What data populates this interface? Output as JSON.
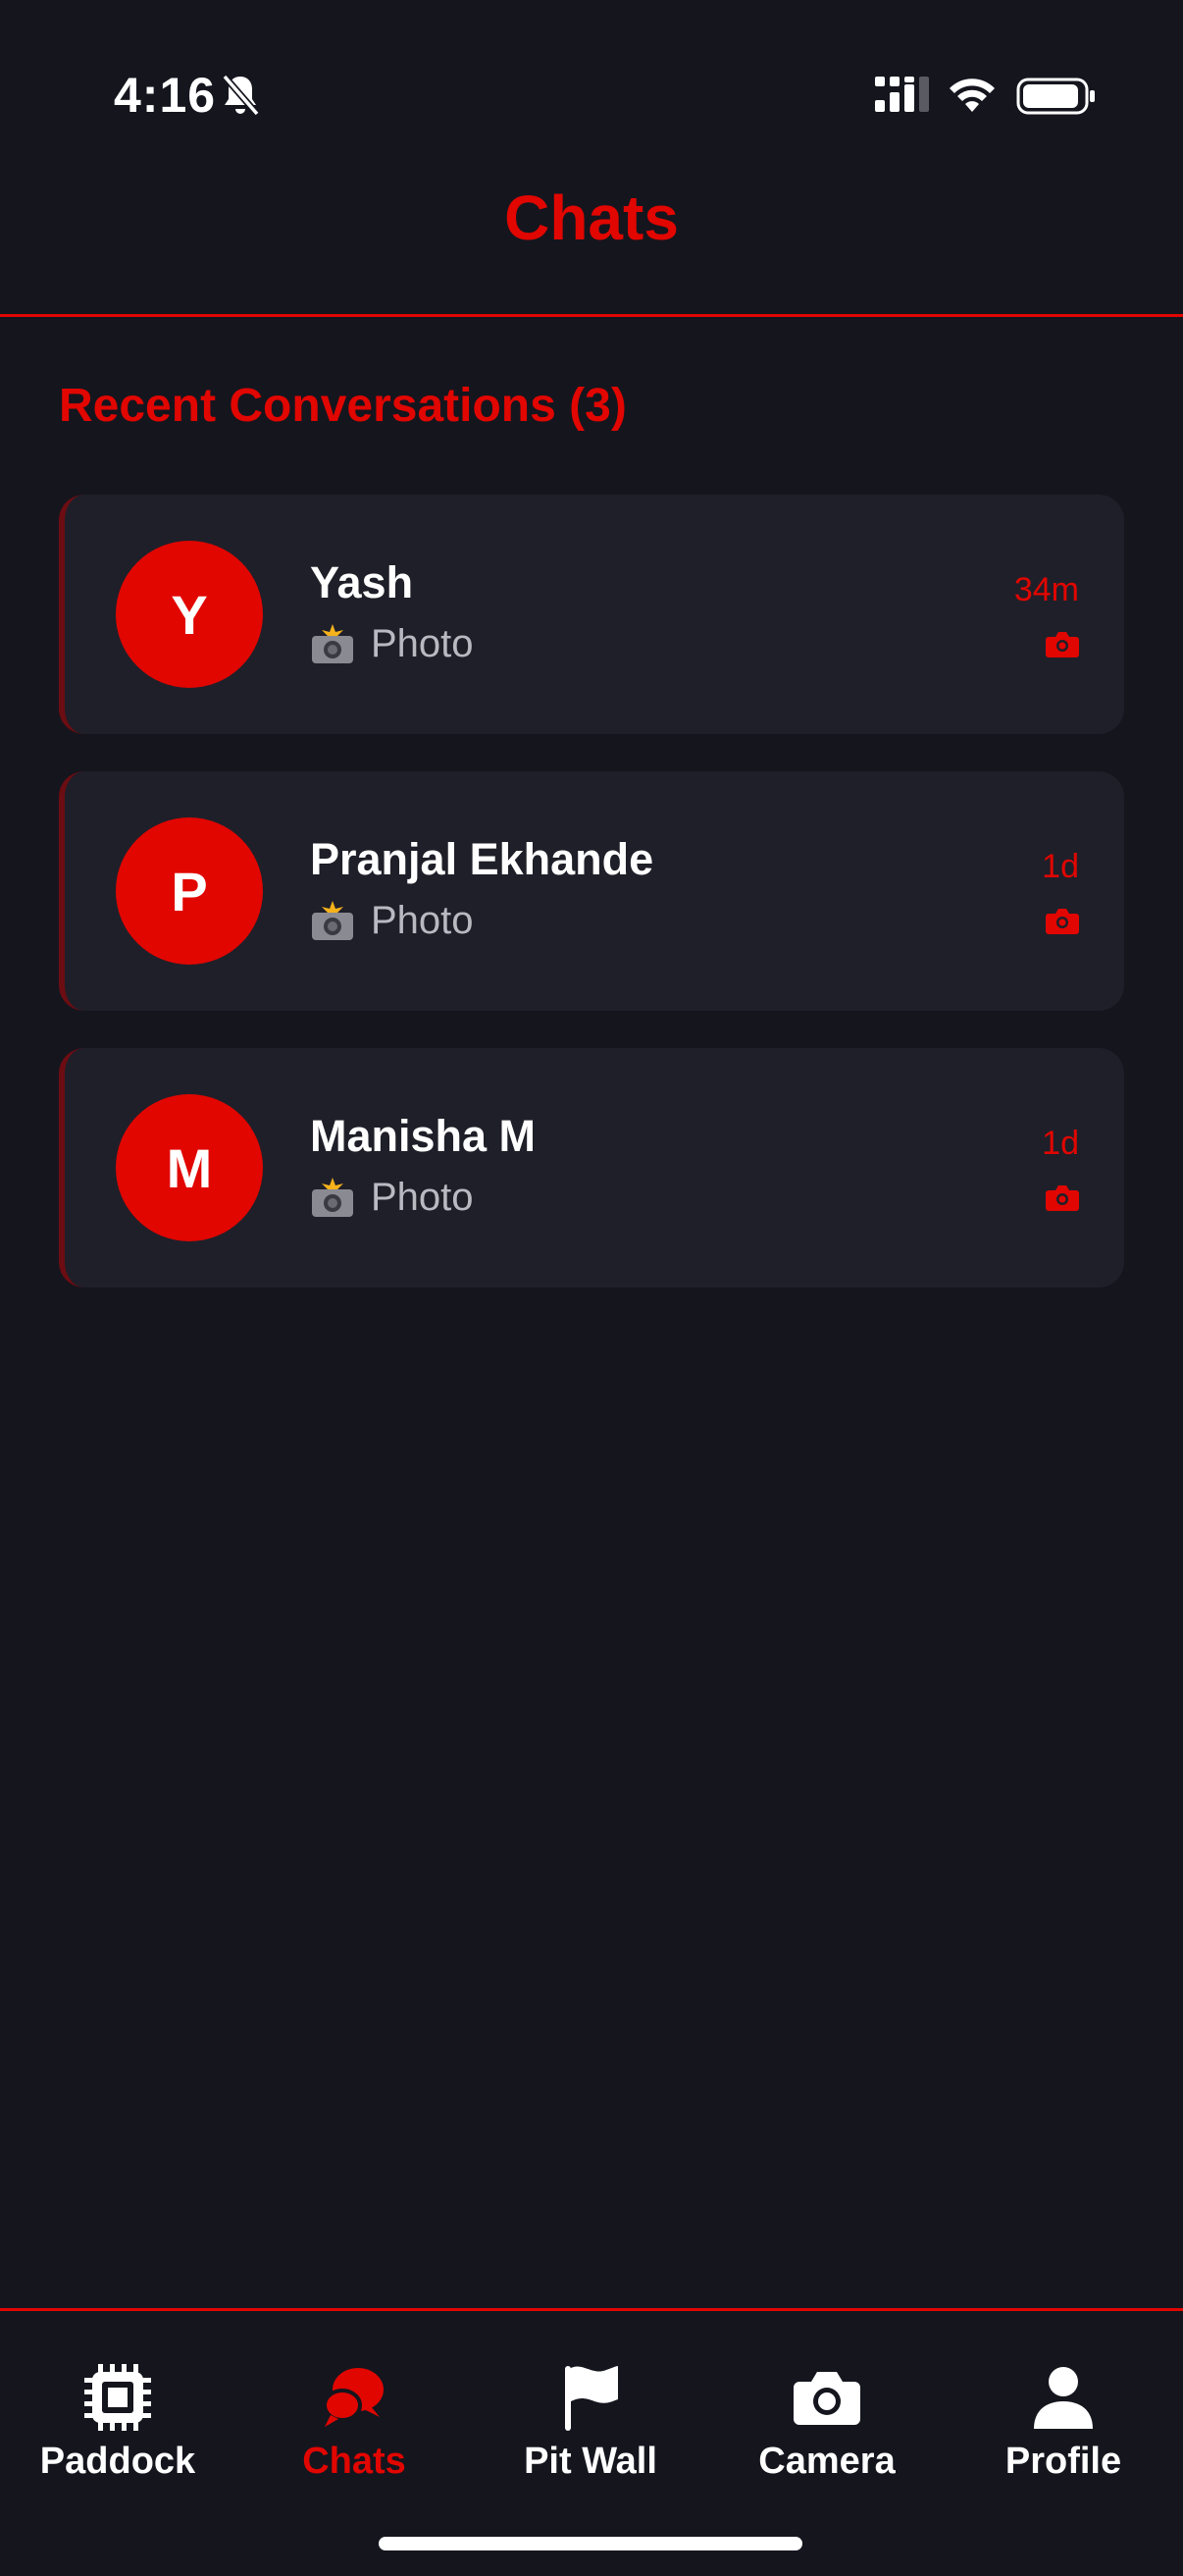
{
  "status_bar": {
    "time": "4:16",
    "icons": [
      "bell-slash-icon",
      "signal-icon",
      "wifi-icon",
      "battery-icon"
    ]
  },
  "header": {
    "title": "Chats"
  },
  "section": {
    "title": "Recent Conversations (3)"
  },
  "conversations": [
    {
      "initial": "Y",
      "name": "Yash",
      "preview": "Photo",
      "time": "34m",
      "preview_icon": "camera-flash-icon",
      "type_icon": "camera-icon"
    },
    {
      "initial": "P",
      "name": "Pranjal Ekhande",
      "preview": "Photo",
      "time": "1d",
      "preview_icon": "camera-flash-icon",
      "type_icon": "camera-icon"
    },
    {
      "initial": "M",
      "name": "Manisha M",
      "preview": "Photo",
      "time": "1d",
      "preview_icon": "camera-flash-icon",
      "type_icon": "camera-icon"
    }
  ],
  "tab_bar": {
    "tabs": [
      {
        "label": "Paddock",
        "icon": "chip-icon",
        "active": false
      },
      {
        "label": "Chats",
        "icon": "chat-bubbles-icon",
        "active": true
      },
      {
        "label": "Pit Wall",
        "icon": "flag-icon",
        "active": false
      },
      {
        "label": "Camera",
        "icon": "camera-icon",
        "active": false
      },
      {
        "label": "Profile",
        "icon": "person-icon",
        "active": false
      }
    ]
  },
  "colors": {
    "accent": "#e10600",
    "background": "#15151e",
    "card": "#1f1f29",
    "secondary_text": "#b9b9c2"
  }
}
